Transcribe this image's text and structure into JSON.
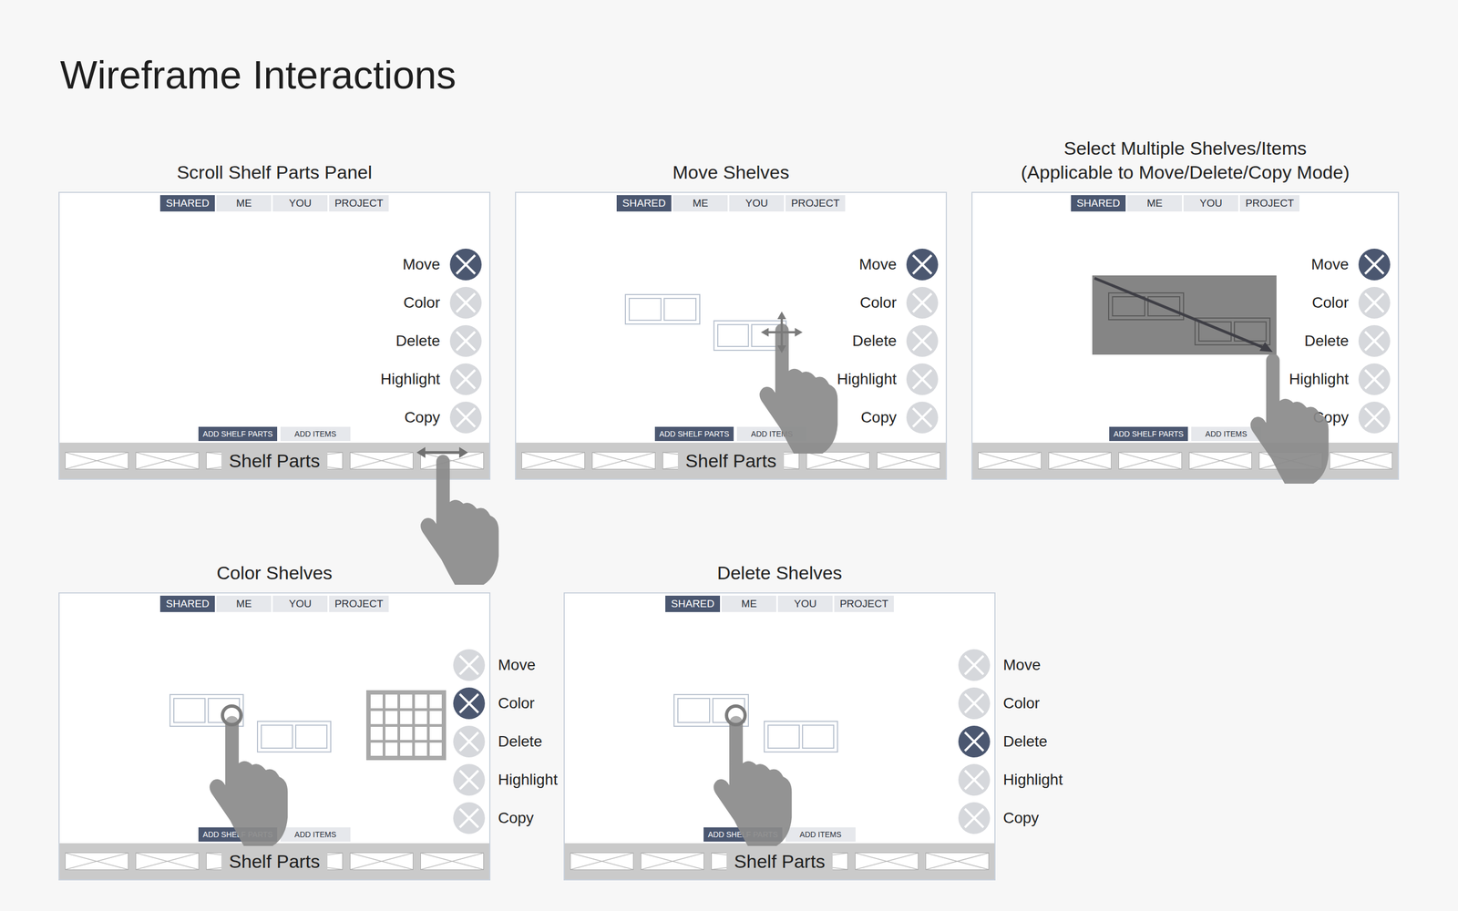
{
  "title": "Wireframe Interactions",
  "panels": [
    {
      "kind": "scroll",
      "title": [
        "Scroll Shelf Parts Panel"
      ],
      "tabs": [
        {
          "label": "SHARED",
          "selected": true
        },
        {
          "label": "ME",
          "selected": false
        },
        {
          "label": "YOU",
          "selected": false
        },
        {
          "label": "PROJECT",
          "selected": false
        }
      ],
      "actions": [
        {
          "label": "Move",
          "selected": true
        },
        {
          "label": "Color",
          "selected": false
        },
        {
          "label": "Delete",
          "selected": false
        },
        {
          "label": "Highlight",
          "selected": false
        },
        {
          "label": "Copy",
          "selected": false
        }
      ],
      "add_buttons": [
        {
          "label": "ADD SHELF PARTS",
          "selected": true
        },
        {
          "label": "ADD ITEMS",
          "selected": false
        }
      ],
      "bar_label": "Shelf Parts"
    },
    {
      "kind": "move",
      "title": [
        "Move Shelves"
      ],
      "tabs": [
        {
          "label": "SHARED",
          "selected": true
        },
        {
          "label": "ME",
          "selected": false
        },
        {
          "label": "YOU",
          "selected": false
        },
        {
          "label": "PROJECT",
          "selected": false
        }
      ],
      "actions": [
        {
          "label": "Move",
          "selected": true
        },
        {
          "label": "Color",
          "selected": false
        },
        {
          "label": "Delete",
          "selected": false
        },
        {
          "label": "Highlight",
          "selected": false
        },
        {
          "label": "Copy",
          "selected": false
        }
      ],
      "add_buttons": [
        {
          "label": "ADD SHELF PARTS",
          "selected": true
        },
        {
          "label": "ADD ITEMS",
          "selected": false
        }
      ],
      "bar_label": "Shelf Parts"
    },
    {
      "kind": "select",
      "title": [
        "Select Multiple Shelves/Items",
        "(Applicable to Move/Delete/Copy Mode)"
      ],
      "tabs": [
        {
          "label": "SHARED",
          "selected": true
        },
        {
          "label": "ME",
          "selected": false
        },
        {
          "label": "YOU",
          "selected": false
        },
        {
          "label": "PROJECT",
          "selected": false
        }
      ],
      "actions": [
        {
          "label": "Move",
          "selected": true
        },
        {
          "label": "Color",
          "selected": false
        },
        {
          "label": "Delete",
          "selected": false
        },
        {
          "label": "Highlight",
          "selected": false
        },
        {
          "label": "Copy",
          "selected": false
        }
      ],
      "add_buttons": [
        {
          "label": "ADD SHELF PARTS",
          "selected": true
        },
        {
          "label": "ADD ITEMS",
          "selected": false
        }
      ]
    },
    {
      "kind": "color",
      "title": [
        "Color Shelves"
      ],
      "tabs": [
        {
          "label": "SHARED",
          "selected": true
        },
        {
          "label": "ME",
          "selected": false
        },
        {
          "label": "YOU",
          "selected": false
        },
        {
          "label": "PROJECT",
          "selected": false
        }
      ],
      "actions": [
        {
          "label": "Move",
          "selected": false
        },
        {
          "label": "Color",
          "selected": true
        },
        {
          "label": "Delete",
          "selected": false
        },
        {
          "label": "Highlight",
          "selected": false
        },
        {
          "label": "Copy",
          "selected": false
        }
      ],
      "add_buttons": [
        {
          "label": "ADD SHELF PARTS",
          "selected": true
        },
        {
          "label": "ADD ITEMS",
          "selected": false
        }
      ],
      "bar_label": "Shelf Parts"
    },
    {
      "kind": "delete",
      "title": [
        "Delete Shelves"
      ],
      "tabs": [
        {
          "label": "SHARED",
          "selected": true
        },
        {
          "label": "ME",
          "selected": false
        },
        {
          "label": "YOU",
          "selected": false
        },
        {
          "label": "PROJECT",
          "selected": false
        }
      ],
      "actions": [
        {
          "label": "Move",
          "selected": false
        },
        {
          "label": "Color",
          "selected": false
        },
        {
          "label": "Delete",
          "selected": true
        },
        {
          "label": "Highlight",
          "selected": false
        },
        {
          "label": "Copy",
          "selected": false
        }
      ],
      "add_buttons": [
        {
          "label": "ADD SHELF PARTS",
          "selected": true
        },
        {
          "label": "ADD ITEMS",
          "selected": false
        }
      ],
      "bar_label": "Shelf Parts"
    }
  ]
}
